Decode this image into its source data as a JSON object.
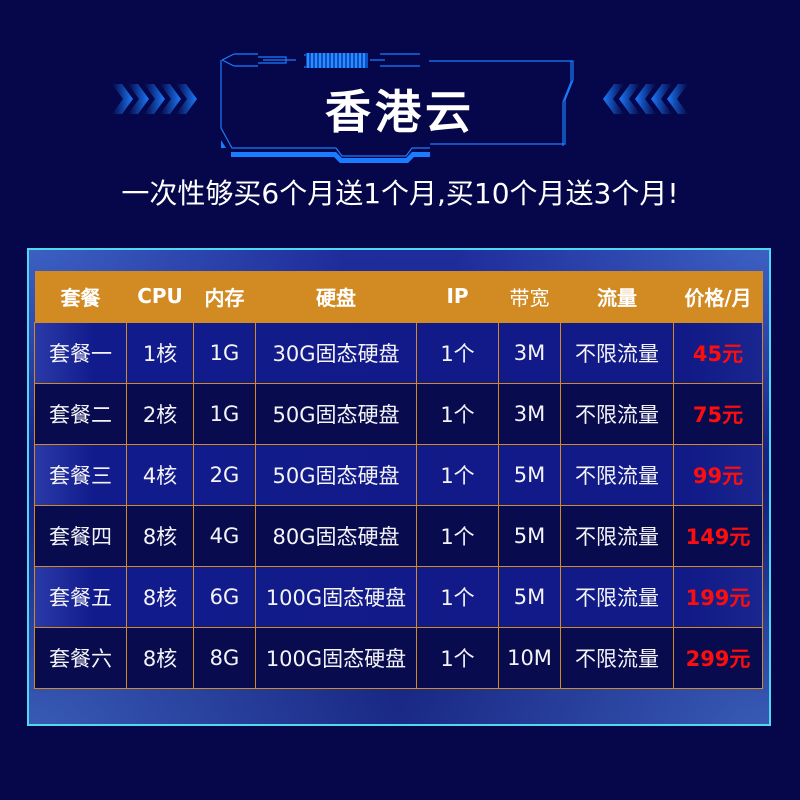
{
  "header": {
    "title": "香港云",
    "subtitle": "一次性够买6个月送1个月,买10个月送3个月!"
  },
  "colors": {
    "background": "#06074a",
    "accent_blue": "#1a7cff",
    "panel_border": "#4fd8f0",
    "table_header": "#d28a22",
    "row_odd": "#121b8c",
    "row_even": "#090b4f",
    "price": "#ff0d0d"
  },
  "icons": {
    "left_decoration": "chevrons-right-icon",
    "right_decoration": "chevrons-left-icon"
  },
  "table": {
    "columns": [
      "套餐",
      "CPU",
      "内存",
      "硬盘",
      "IP",
      "带宽",
      "流量",
      "价格/月"
    ],
    "rows": [
      {
        "plan": "套餐一",
        "cpu": "1核",
        "memory": "1G",
        "disk": "30G固态硬盘",
        "ip": "1个",
        "bandwidth": "3M",
        "traffic": "不限流量",
        "price": "45元"
      },
      {
        "plan": "套餐二",
        "cpu": "2核",
        "memory": "1G",
        "disk": "50G固态硬盘",
        "ip": "1个",
        "bandwidth": "3M",
        "traffic": "不限流量",
        "price": "75元"
      },
      {
        "plan": "套餐三",
        "cpu": "4核",
        "memory": "2G",
        "disk": "50G固态硬盘",
        "ip": "1个",
        "bandwidth": "5M",
        "traffic": "不限流量",
        "price": "99元"
      },
      {
        "plan": "套餐四",
        "cpu": "8核",
        "memory": "4G",
        "disk": "80G固态硬盘",
        "ip": "1个",
        "bandwidth": "5M",
        "traffic": "不限流量",
        "price": "149元"
      },
      {
        "plan": "套餐五",
        "cpu": "8核",
        "memory": "6G",
        "disk": "100G固态硬盘",
        "ip": "1个",
        "bandwidth": "5M",
        "traffic": "不限流量",
        "price": "199元"
      },
      {
        "plan": "套餐六",
        "cpu": "8核",
        "memory": "8G",
        "disk": "100G固态硬盘",
        "ip": "1个",
        "bandwidth": "10M",
        "traffic": "不限流量",
        "price": "299元"
      }
    ]
  }
}
